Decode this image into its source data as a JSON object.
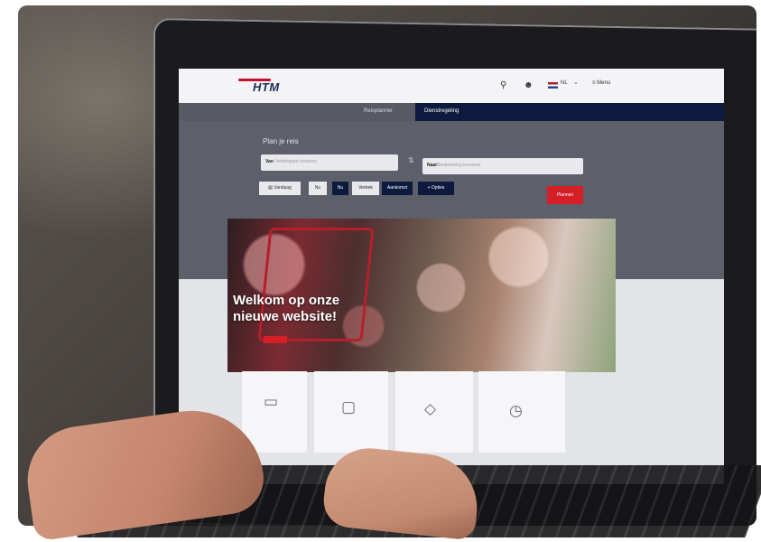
{
  "site": {
    "logo": "HTM",
    "search_icon": "search-icon",
    "user_icon": "user-icon",
    "language": "NL",
    "menu_label": "Menu"
  },
  "tabs": [
    "Reisplanner",
    "Dienstregeling"
  ],
  "planner": {
    "title": "Plan je reis",
    "from_tag": "Van",
    "from_placeholder": "Vertrekpunt invoeren",
    "to_tag": "Naar",
    "to_placeholder": "Bestemming invoeren",
    "options": [
      "Vandaag",
      "Nu",
      "Nu",
      "Vertrek",
      "Aankomst",
      "Opties"
    ],
    "submit_label": "Plannen"
  },
  "banner": {
    "headline_line1": "Welkom op onze",
    "headline_line2": "nieuwe website!"
  },
  "cards": [
    {
      "icon": "ticket-icon"
    },
    {
      "icon": "touch-screen-icon"
    },
    {
      "icon": "tickets-icon"
    },
    {
      "icon": "clock-coins-icon"
    }
  ],
  "colors": {
    "brand_red": "#d51f26",
    "navy": "#0c1a3d",
    "slate": "#5d5f6a"
  }
}
